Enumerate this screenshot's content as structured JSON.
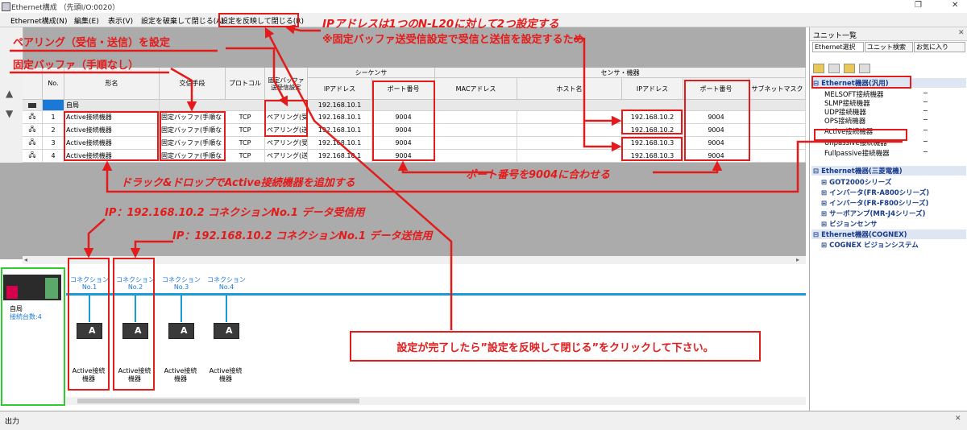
{
  "window": {
    "title": "Ethernet構成 （先頭I/O:0020）",
    "buttons": {
      "restore": "❐",
      "close": "✕"
    }
  },
  "menu": [
    {
      "label": "Ethernet構成(N)"
    },
    {
      "label": "編集(E)"
    },
    {
      "label": "表示(V)"
    },
    {
      "label": "設定を破棄して閉じる(A)"
    },
    {
      "label": "設定を反映して閉じる(R)"
    }
  ],
  "grid": {
    "group_headers": {
      "sequencer": "シーケンサ",
      "sensor": "センサ・機器"
    },
    "columns": {
      "no": "No.",
      "model": "形名",
      "comm": "交信手段",
      "protocol": "プロトコル",
      "fixed_buffer": "固定バッファ送受信設定",
      "seq_ip": "IPアドレス",
      "seq_port": "ポート番号",
      "mac": "MACアドレス",
      "host": "ホスト名",
      "sen_ip": "IPアドレス",
      "sen_port": "ポート番号",
      "subnet": "サブネットマスク"
    },
    "self_row": {
      "model": "自局",
      "seq_ip": "192.168.10.1"
    },
    "rows": [
      {
        "no": "1",
        "model": "Active接続機器",
        "comm": "固定バッファ(手順な",
        "protocol": "TCP",
        "fixed": "ペアリング(受",
        "seq_ip": "192.168.10.1",
        "seq_port": "9004",
        "sen_ip": "192.168.10.2",
        "sen_port": "9004"
      },
      {
        "no": "2",
        "model": "Active接続機器",
        "comm": "固定バッファ(手順な",
        "protocol": "TCP",
        "fixed": "ペアリング(送",
        "seq_ip": "192.168.10.1",
        "seq_port": "9004",
        "sen_ip": "192.168.10.2",
        "sen_port": "9004"
      },
      {
        "no": "3",
        "model": "Active接続機器",
        "comm": "固定バッファ(手順な",
        "protocol": "TCP",
        "fixed": "ペアリング(受",
        "seq_ip": "192.168.10.1",
        "seq_port": "9004",
        "sen_ip": "192.168.10.3",
        "sen_port": "9004"
      },
      {
        "no": "4",
        "model": "Active接続機器",
        "comm": "固定バッファ(手順な",
        "protocol": "TCP",
        "fixed": "ペアリング(送",
        "seq_ip": "192.168.10.1",
        "seq_port": "9004",
        "sen_ip": "192.168.10.3",
        "sen_port": "9004"
      }
    ]
  },
  "connection_view": {
    "station": {
      "label": "自局",
      "count": "接続台数:4"
    },
    "connections": [
      {
        "label": "コネクション",
        "no": "No.1",
        "device_line1": "Active接続",
        "device_line2": "機器"
      },
      {
        "label": "コネクション",
        "no": "No.2",
        "device_line1": "Active接続",
        "device_line2": "機器"
      },
      {
        "label": "コネクション",
        "no": "No.3",
        "device_line1": "Active接続",
        "device_line2": "機器"
      },
      {
        "label": "コネクション",
        "no": "No.4",
        "device_line1": "Active接続",
        "device_line2": "機器"
      }
    ]
  },
  "output": {
    "label": "出力"
  },
  "unit_list": {
    "title": "ユニット一覧",
    "tabs": [
      {
        "label": "Ethernet選択"
      },
      {
        "label": "ユニット検索"
      },
      {
        "label": "お気に入り"
      }
    ],
    "categories": [
      {
        "label": "Ethernet機器(汎用)",
        "items": [
          {
            "label": "MELSOFT接続機器",
            "value": "−"
          },
          {
            "label": "SLMP接続機器",
            "value": "−"
          },
          {
            "label": "UDP接続機器",
            "value": "−"
          },
          {
            "label": "OPS接続機器",
            "value": "−"
          },
          {
            "label": "Active接続機器",
            "value": "−"
          },
          {
            "label": "Unpassive接続機器",
            "value": "−"
          },
          {
            "label": "Fullpassive接続機器",
            "value": "−"
          }
        ]
      },
      {
        "label": "Ethernet機器(三菱電機)",
        "subs": [
          {
            "label": "GOT2000シリーズ"
          },
          {
            "label": "インバータ(FR-A800シリーズ)"
          },
          {
            "label": "インバータ(FR-F800シリーズ)"
          },
          {
            "label": "サーボアンプ(MR-J4シリーズ)"
          },
          {
            "label": "ビジョンセンサ"
          }
        ]
      },
      {
        "label": "Ethernet機器(COGNEX)",
        "subs": [
          {
            "label": "COGNEX ビジョンシステム"
          }
        ]
      }
    ]
  },
  "annotations": {
    "ip_note": "IPアドレスは1つのN-L20に対して2つ設定する",
    "ip_note_sub": "※固定バッファ送受信設定で受信と送信を設定するため",
    "pairing": "ペアリング（受信・送信）を設定",
    "fixed_buffer": "固定バッファ（手順なし）",
    "drag_drop": "ドラック&ドロップでActive接続機器を追加する",
    "port_match": "ポート番号を9004に合わせる",
    "conn1": "IP：192.168.10.2 コネクションNo.1 データ受信用",
    "conn2": "IP：192.168.10.2 コネクションNo.1 データ送信用",
    "finish": "設定が完了したら”設定を反映して閉じる”をクリックして下さい。"
  },
  "colors": {
    "annotation_red": "#e31b1b",
    "highlight_green": "#2ecc2e",
    "link_blue": "#1a78d6"
  }
}
